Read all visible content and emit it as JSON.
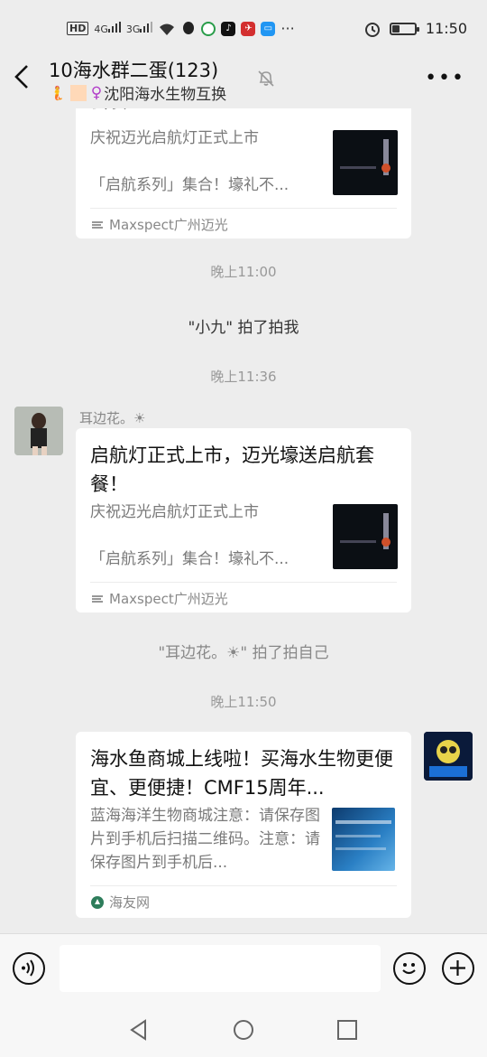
{
  "status_bar": {
    "net_label": "HD",
    "sig1": "4G",
    "sig2": "3G",
    "time": "11:50",
    "battery_level": 0.3,
    "icons": [
      "signal-icon",
      "wifi-icon",
      "qq-icon",
      "app-icon",
      "douyin-icon",
      "app2-icon",
      "app3-icon",
      "more-icon",
      "alarm-icon",
      "battery-icon"
    ]
  },
  "header": {
    "title": "10海水群二蛋(123)",
    "subtitle": "沈阳海水生物互换",
    "subtitle_prefix_emoji": "🧜 ♀"
  },
  "messages": {
    "card1": {
      "title_tail": "套餐！",
      "desc": "庆祝迈光启航灯正式上市\n\n「启航系列」集合！壕礼不...",
      "source": "Maxspect广州迈光"
    },
    "time1": "晚上11:00",
    "sys1_name": "\"小九\"",
    "sys1_action": " 拍了拍我",
    "time2": "晚上11:36",
    "sender2": "耳边花。☀",
    "card2": {
      "title": "启航灯正式上市，迈光壕送启航套餐！",
      "desc": "庆祝迈光启航灯正式上市\n\n「启航系列」集合！壕礼不...",
      "source": "Maxspect广州迈光"
    },
    "sys2": "\"耳边花。☀\" 拍了拍自己",
    "time3": "晚上11:50",
    "card3": {
      "title": "海水鱼商城上线啦！买海水生物更便宜、更便捷！CMF15周年...",
      "desc": "蓝海海洋生物商城注意：请保存图片到手机后扫描二维码。注意：请保存图片到手机后...",
      "source": "海友网"
    }
  },
  "input": {
    "placeholder": ""
  },
  "colors": {
    "background": "#ededed",
    "card": "#ffffff",
    "muted_text": "#888888"
  }
}
